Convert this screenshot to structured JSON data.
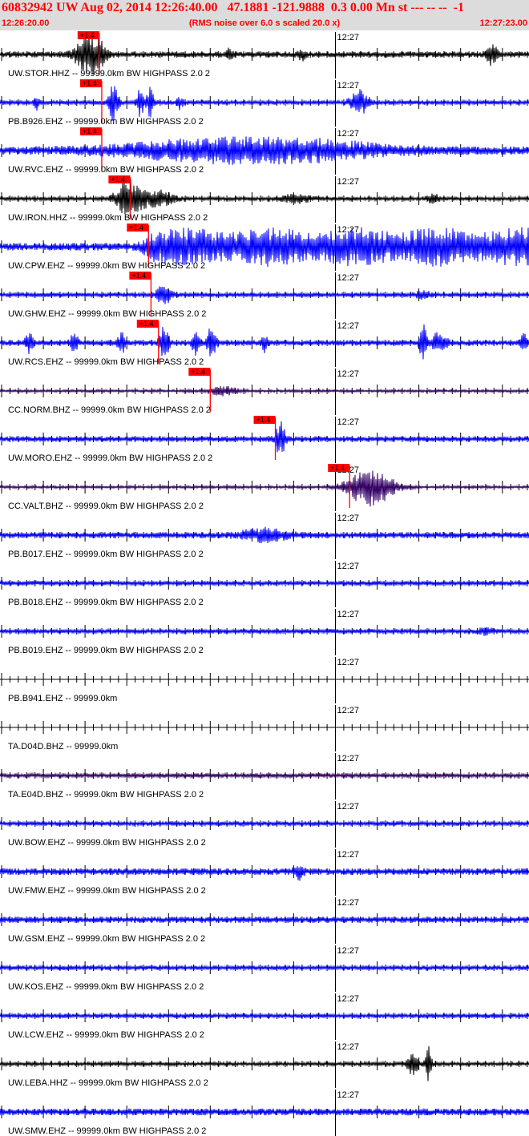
{
  "header": {
    "title": "60832942 UW Aug 02, 2014 12:26:40.00   47.1881 -121.9888  0.3 0.00 Mn st --- -- --  -1",
    "start_time": "12:26:20.00",
    "scale_note": "(RMS noise over 6.0 s scaled 20.0 x)",
    "end_time": "12:27:23.00"
  },
  "colors": {
    "header_bg": "#dcdcdc",
    "header_text": "#ff0000",
    "pick": "#ff0000",
    "grid": "#000000"
  },
  "chart_data": {
    "type": "line",
    "x_range": [
      "12:26:20.00",
      "12:27:23.00"
    ],
    "minute_mark_label": "12:27",
    "minute_mark_time": "12:27:00",
    "pick_label": "+1.4",
    "traces": [
      {
        "label": "UW.STOR.HHZ -- 99999.0km BW  HIGHPASS  2.0  2",
        "color": "#000000",
        "pick_time": "12:26:31.7",
        "noise": 0.15,
        "events": [
          [
            0.155,
            0.6,
            0.012
          ],
          [
            0.175,
            0.9,
            0.01
          ],
          [
            0.19,
            0.4,
            0.01
          ],
          [
            0.435,
            0.3,
            0.005
          ],
          [
            0.57,
            0.25,
            0.005
          ],
          [
            0.93,
            0.5,
            0.007
          ]
        ]
      },
      {
        "label": "PB.B926.EHZ -- 99999.0km BW  HIGHPASS  2.0  2",
        "color": "#0000ff",
        "pick_time": "12:26:32.0",
        "noise": 0.12,
        "events": [
          [
            0.215,
            0.95,
            0.006
          ],
          [
            0.265,
            0.7,
            0.005
          ],
          [
            0.285,
            0.8,
            0.005
          ],
          [
            0.68,
            0.6,
            0.012
          ],
          [
            0.07,
            0.3,
            0.004
          ],
          [
            0.34,
            0.3,
            0.004
          ]
        ]
      },
      {
        "label": "UW.RVC.EHZ -- 99999.0km BW  HIGHPASS  2.0  2",
        "color": "#0000ff",
        "pick_time": "12:26:32.0",
        "noise": 0.22,
        "events": [
          [
            0.4,
            0.45,
            0.12
          ],
          [
            0.6,
            0.35,
            0.1
          ]
        ]
      },
      {
        "label": "UW.IRON.HHZ -- 99999.0km BW  HIGHPASS  2.0  2",
        "color": "#000000",
        "pick_time": "12:26:35.4",
        "noise": 0.1,
        "events": [
          [
            0.245,
            0.95,
            0.018
          ],
          [
            0.3,
            0.4,
            0.02
          ],
          [
            0.56,
            0.2,
            0.02
          ],
          [
            0.82,
            0.2,
            0.01
          ]
        ]
      },
      {
        "label": "UW.CPW.EHZ -- 99999.0km BW  HIGHPASS  2.0  2",
        "color": "#0000ff",
        "pick_time": "12:26:37.6",
        "noise": 0.2,
        "plateau": [
          0.29,
          1.0,
          0.85
        ]
      },
      {
        "label": "UW.GHW.EHZ -- 99999.0km BW  HIGHPASS  2.0  2",
        "color": "#0000ff",
        "pick_time": "12:26:37.9",
        "noise": 0.12,
        "events": [
          [
            0.31,
            0.5,
            0.01
          ],
          [
            0.8,
            0.15,
            0.01
          ]
        ]
      },
      {
        "label": "UW.RCS.EHZ -- 99999.0km BW  HIGHPASS  2.0  2",
        "color": "#0000ff",
        "pick_time": "12:26:38.8",
        "noise": 0.14,
        "events": [
          [
            0.055,
            0.5,
            0.005
          ],
          [
            0.14,
            0.5,
            0.005
          ],
          [
            0.23,
            0.5,
            0.005
          ],
          [
            0.31,
            0.95,
            0.006
          ],
          [
            0.37,
            0.6,
            0.005
          ],
          [
            0.4,
            0.8,
            0.006
          ],
          [
            0.5,
            0.4,
            0.005
          ],
          [
            0.8,
            0.85,
            0.005
          ],
          [
            0.83,
            0.5,
            0.01
          ],
          [
            0.99,
            0.4,
            0.005
          ]
        ]
      },
      {
        "label": "CC.NORM.BHZ -- 99999.0km BW  HIGHPASS  2.0  2",
        "color": "#330066",
        "pick_time": "12:26:45.0",
        "noise": 0.07,
        "events": [
          [
            0.42,
            0.22,
            0.02
          ]
        ]
      },
      {
        "label": "UW.MORO.EHZ -- 99999.0km BW  HIGHPASS  2.0  2",
        "color": "#0000ff",
        "pick_time": "12:26:52.8",
        "noise": 0.14,
        "events": [
          [
            0.53,
            0.9,
            0.006
          ]
        ]
      },
      {
        "label": "CC.VALT.BHZ -- 99999.0km BW  HIGHPASS  2.0  2",
        "color": "#330066",
        "pick_time": "12:27:01.7",
        "noise": 0.07,
        "events": [
          [
            0.7,
            1.0,
            0.03
          ]
        ]
      },
      {
        "label": "PB.B017.EHZ -- 99999.0km BW  HIGHPASS  2.0  2",
        "color": "#0000ff",
        "noise": 0.16,
        "events": [
          [
            0.5,
            0.3,
            0.03
          ]
        ]
      },
      {
        "label": "PB.B018.EHZ -- 99999.0km BW  HIGHPASS  2.0  2",
        "color": "#0000ff",
        "noise": 0.12
      },
      {
        "label": "PB.B019.EHZ -- 99999.0km BW  HIGHPASS  2.0  2",
        "color": "#0000ff",
        "noise": 0.12,
        "events": [
          [
            0.92,
            0.2,
            0.01
          ]
        ]
      },
      {
        "label": "PB.B941.EHZ -- 99999.0km",
        "color": "#0000ff",
        "noise": 0
      },
      {
        "label": "TA.D04D.BHZ -- 99999.0km",
        "color": "#330066",
        "noise": 0
      },
      {
        "label": "TA.E04D.BHZ -- 99999.0km BW  HIGHPASS  2.0  2",
        "color": "#330066",
        "noise": 0.12
      },
      {
        "label": "UW.BOW.EHZ -- 99999.0km BW  HIGHPASS  2.0  2",
        "color": "#0000ff",
        "noise": 0.12
      },
      {
        "label": "UW.FMW.EHZ -- 99999.0km BW  HIGHPASS  2.0  2",
        "color": "#0000ff",
        "noise": 0.17,
        "events": [
          [
            0.565,
            0.35,
            0.006
          ]
        ]
      },
      {
        "label": "UW.GSM.EHZ -- 99999.0km BW  HIGHPASS  2.0  2",
        "color": "#0000ff",
        "noise": 0.16
      },
      {
        "label": "UW.KOS.EHZ -- 99999.0km BW  HIGHPASS  2.0  2",
        "color": "#0000ff",
        "noise": 0.12
      },
      {
        "label": "UW.LCW.EHZ -- 99999.0km BW  HIGHPASS  2.0  2",
        "color": "#0000ff",
        "noise": 0.12
      },
      {
        "label": "UW.LEBA.HHZ -- 99999.0km BW  HIGHPASS  2.0  2",
        "color": "#000000",
        "noise": 0.1,
        "events": [
          [
            0.78,
            0.5,
            0.008
          ],
          [
            0.81,
            0.9,
            0.004
          ]
        ]
      },
      {
        "label": "UW.SMW.EHZ -- 99999.0km BW  HIGHPASS  2.0  2",
        "color": "#0000ff",
        "noise": 0.18
      }
    ]
  }
}
